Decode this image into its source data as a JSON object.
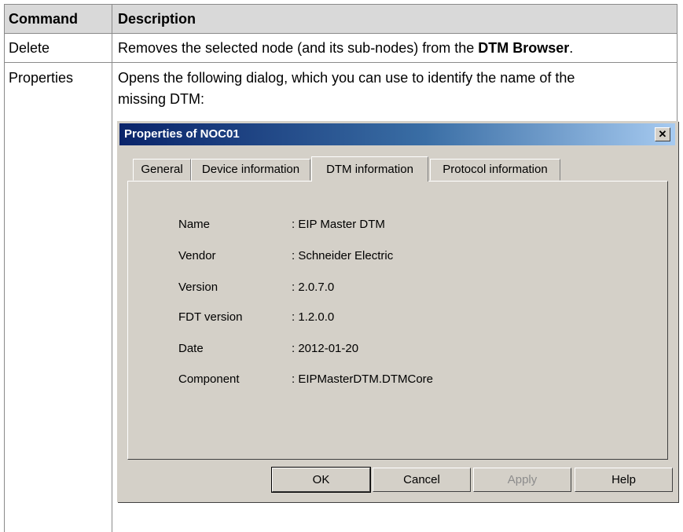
{
  "table": {
    "header": {
      "command": "Command",
      "description": "Description"
    },
    "rows": [
      {
        "command": "Delete",
        "description_pre": "Removes the selected node (and its sub-nodes) from the ",
        "description_bold": "DTM Browser",
        "description_post": "."
      },
      {
        "command": "Properties",
        "description_line1": "Opens the following dialog, which you can use to identify the name of the",
        "description_line2": "missing DTM:"
      }
    ]
  },
  "dialog": {
    "title": "Properties of NOC01",
    "close_glyph": "✕",
    "tabs": [
      {
        "label": "General",
        "active": false
      },
      {
        "label": "Device information",
        "active": false
      },
      {
        "label": "DTM information",
        "active": true
      },
      {
        "label": "Protocol information",
        "active": false
      }
    ],
    "fields": [
      {
        "label": "Name",
        "value": ": EIP Master DTM"
      },
      {
        "label": "Vendor",
        "value": ": Schneider Electric"
      },
      {
        "label": "Version",
        "value": ": 2.0.7.0"
      },
      {
        "label": "FDT version",
        "value": ": 1.2.0.0"
      },
      {
        "label": "Date",
        "value": ": 2012-01-20"
      },
      {
        "label": "Component",
        "value": ": EIPMasterDTM.DTMCore"
      }
    ],
    "buttons": [
      {
        "label": "OK",
        "enabled": true
      },
      {
        "label": "Cancel",
        "enabled": true
      },
      {
        "label": "Apply",
        "enabled": false
      },
      {
        "label": "Help",
        "enabled": true
      }
    ]
  }
}
